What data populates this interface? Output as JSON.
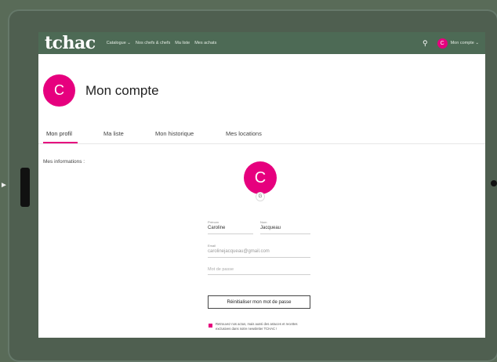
{
  "app": {
    "logo": "tchac"
  },
  "nav": {
    "links": [
      "Catalogue ⌄",
      "Nos chefs & chefs",
      "Ma liste",
      "Mes achats"
    ],
    "account_initial": "C",
    "account_label": "Mon compte ⌄"
  },
  "header": {
    "avatar_initial": "C",
    "title": "Mon compte"
  },
  "tabs": [
    {
      "label": "Mon profil",
      "active": true
    },
    {
      "label": "Ma liste",
      "active": false
    },
    {
      "label": "Mon historique",
      "active": false
    },
    {
      "label": "Mes locations",
      "active": false
    }
  ],
  "profile": {
    "section_label": "Mes informations :",
    "avatar_initial": "C",
    "provider_badge": "G",
    "first_name_label": "Prénom",
    "first_name_value": "Caroline",
    "last_name_label": "Nom",
    "last_name_value": "Jacqueau",
    "email_label": "Email",
    "email_value": "carolinejacqueau@gmail.com",
    "password_placeholder": "Mot de passe",
    "reset_password_label": "Réinitialiser mon mot de passe",
    "newsletter_text": "Retrouvez nos actus, mais aussi des astuces et recettes exclusives dans notre newsletter TCHAC !",
    "newsletter_checked": true
  },
  "colors": {
    "nav_bg": "#4d6a55",
    "accent": "#e6007e"
  }
}
